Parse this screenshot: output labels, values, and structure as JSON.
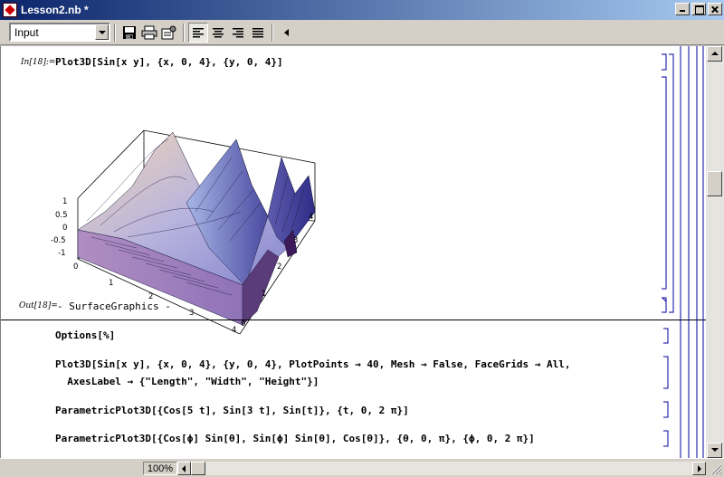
{
  "window": {
    "title": "Lesson2.nb *"
  },
  "toolbar": {
    "style_value": "Input"
  },
  "cells": {
    "in18_label": "In[18]:=",
    "in18_code": "Plot3D[Sin[x y], {x, 0, 4}, {y, 0, 4}]",
    "out18_label": "Out[18]=",
    "out18_text": "- SurfaceGraphics -",
    "c1": "Options[%]",
    "c2_line1": "Plot3D[Sin[x y], {x, 0, 4}, {y, 0, 4}, PlotPoints → 40, Mesh → False, FaceGrids → All,",
    "c2_line2": "  AxesLabel → {\"Length\", \"Width\", \"Height\"}]",
    "c3": "ParametricPlot3D[{Cos[5 t], Sin[3 t], Sin[t]}, {t, 0, 2 π}]",
    "c4": "ParametricPlot3D[{Cos[ϕ] Sin[θ], Sin[ϕ] Sin[θ], Cos[θ]}, {θ, 0, π}, {ϕ, 0, 2 π}]"
  },
  "plot": {
    "z_ticks": [
      "1",
      "0.5",
      "0",
      "-0.5",
      "-1"
    ],
    "x_ticks": [
      "0",
      "1",
      "2",
      "3",
      "4"
    ],
    "y_ticks": [
      "0",
      "1",
      "2",
      "3",
      "4"
    ]
  },
  "status": {
    "zoom": "100%"
  },
  "icons": [
    "save-icon",
    "print-icon",
    "preferences-icon",
    "align-left-icon",
    "align-center-icon",
    "align-right-icon",
    "justify-icon",
    "triangle-left-icon"
  ]
}
